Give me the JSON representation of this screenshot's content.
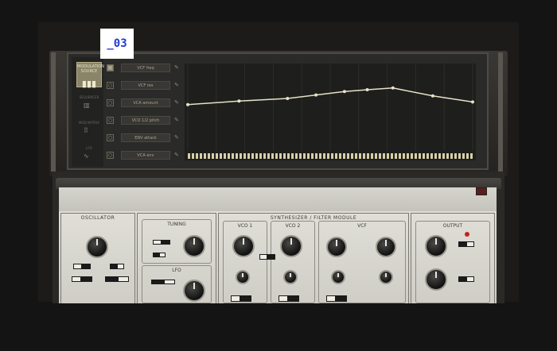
{
  "screen_tag": "_03",
  "left_panel": {
    "preset_label": "MODULATION SOURCE",
    "items": [
      {
        "label": "SEQUENCER",
        "icon": "bars-icon"
      },
      {
        "label": "MOD MATRIX",
        "icon": "grid-icon"
      },
      {
        "label": "LFO",
        "icon": "wave-icon"
      }
    ]
  },
  "mod_rows": [
    {
      "checked": true,
      "label": "VCF freq"
    },
    {
      "checked": false,
      "label": "VCF res"
    },
    {
      "checked": false,
      "label": "VCA amount"
    },
    {
      "checked": false,
      "label": "VCO 1/2 pitch"
    },
    {
      "checked": false,
      "label": "ENV attack"
    },
    {
      "checked": false,
      "label": "VCA env"
    }
  ],
  "graph": {
    "points": [
      [
        0,
        0.47
      ],
      [
        0.18,
        0.43
      ],
      [
        0.35,
        0.4
      ],
      [
        0.45,
        0.36
      ],
      [
        0.55,
        0.32
      ],
      [
        0.63,
        0.3
      ],
      [
        0.72,
        0.28
      ],
      [
        0.86,
        0.37
      ],
      [
        1.0,
        0.44
      ]
    ],
    "line_color": "#e6e2c8"
  },
  "synth": {
    "header": "SYNTHESIZER / FILTER MODULE",
    "sections": [
      {
        "title": "OSCILLATOR"
      },
      {
        "title": "TUNING"
      },
      {
        "title": "LFO"
      },
      {
        "title": "VCO 1"
      },
      {
        "title": "VCO 2"
      },
      {
        "title": "VCF"
      },
      {
        "title": "OUTPUT"
      }
    ]
  },
  "colors": {
    "accent": "#8a8468",
    "led": "#c42020"
  }
}
